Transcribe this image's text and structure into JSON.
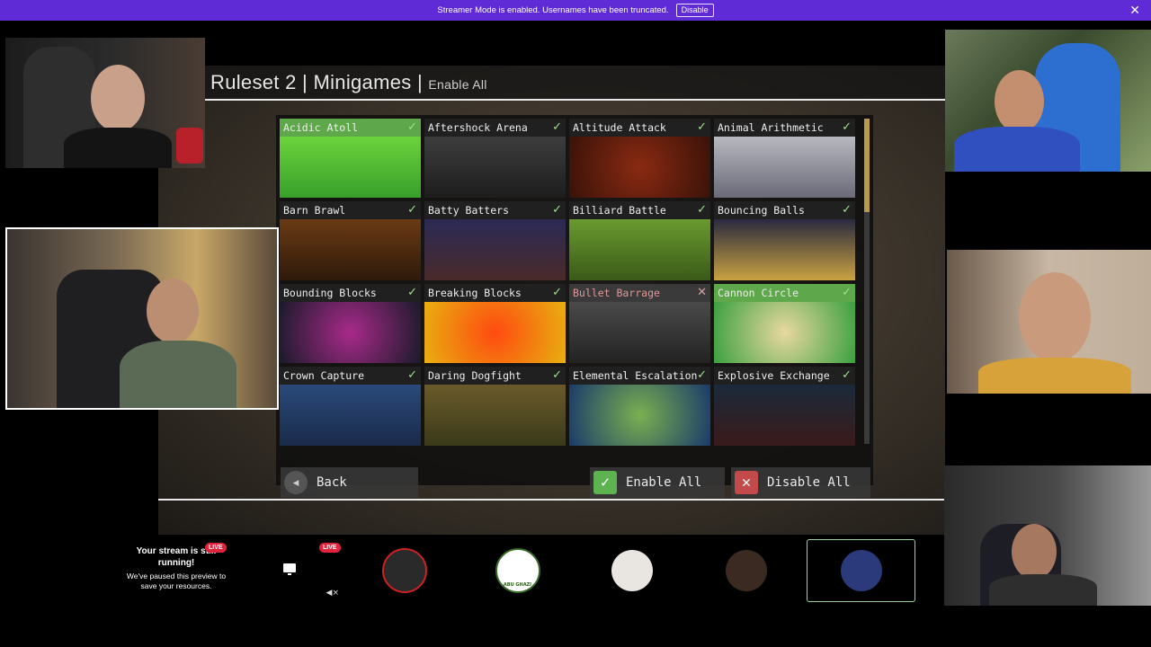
{
  "banner": {
    "message": "Streamer Mode is enabled. Usernames have been truncated.",
    "disable_label": "Disable",
    "close_glyph": "✕"
  },
  "game": {
    "title_main": "Ruleset 2 | Minigames |",
    "title_enable_all": "Enable All",
    "minigames": [
      {
        "name": "Acidic Atoll",
        "enabled": true
      },
      {
        "name": "Aftershock Arena",
        "enabled": true
      },
      {
        "name": "Altitude Attack",
        "enabled": true
      },
      {
        "name": "Animal Arithmetic",
        "enabled": true
      },
      {
        "name": "Barn Brawl",
        "enabled": true
      },
      {
        "name": "Batty Batters",
        "enabled": true
      },
      {
        "name": "Billiard Battle",
        "enabled": true
      },
      {
        "name": "Bouncing Balls",
        "enabled": true
      },
      {
        "name": "Bounding Blocks",
        "enabled": true
      },
      {
        "name": "Breaking Blocks",
        "enabled": true
      },
      {
        "name": "Bullet Barrage",
        "enabled": false
      },
      {
        "name": "Cannon Circle",
        "enabled": true
      },
      {
        "name": "Crown Capture",
        "enabled": true
      },
      {
        "name": "Daring Dogfight",
        "enabled": true
      },
      {
        "name": "Elemental Escalation",
        "enabled": true
      },
      {
        "name": "Explosive Exchange",
        "enabled": true
      }
    ],
    "back_label": "Back",
    "enable_all_label": "Enable All",
    "disable_all_label": "Disable All"
  },
  "stream": {
    "title": "Your stream is still running!",
    "subtitle": "We've paused this preview to save your resources.",
    "live_label": "LIVE"
  },
  "participants": [
    {
      "name_visible": "",
      "color": "#4a3036"
    },
    {
      "name_visible": "ABU GHAZI",
      "color": "#ece4d6"
    },
    {
      "name_visible": "",
      "color": "#cda594"
    },
    {
      "name_visible": "",
      "color": "#cbb9cc"
    },
    {
      "name_visible": "",
      "color": "#2a2450"
    }
  ]
}
